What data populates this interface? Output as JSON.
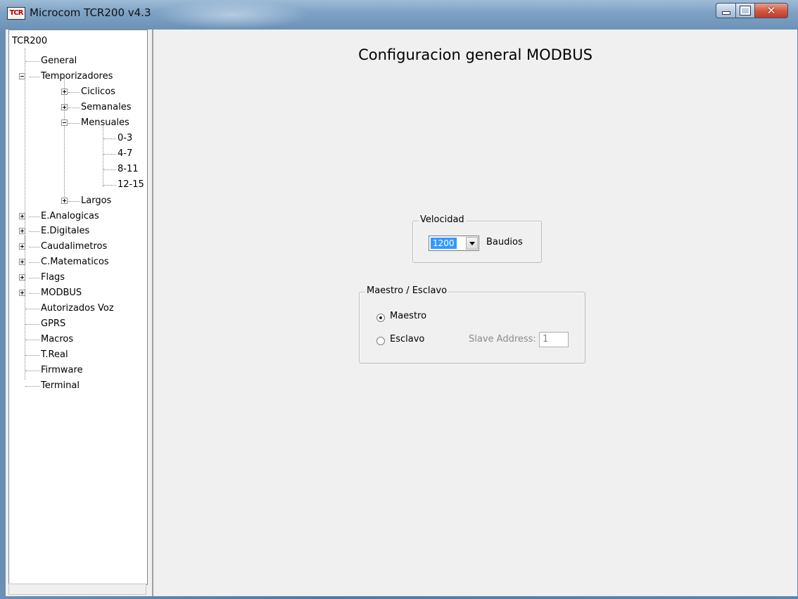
{
  "window": {
    "title": "Microcom TCR200 v4.3",
    "icon_text": "TCR",
    "controls": [
      "minimize-icon",
      "maximize-icon",
      "close-icon"
    ],
    "accent_color": "#3399ff"
  },
  "tree": {
    "root": "TCR200",
    "nodes": [
      {
        "label": "General"
      },
      {
        "label": "Temporizadores",
        "state": "expanded"
      },
      {
        "label": "Ciclicos",
        "state": "collapsed"
      },
      {
        "label": "Semanales",
        "state": "collapsed"
      },
      {
        "label": "Mensuales",
        "state": "expanded"
      },
      {
        "label": "0-3"
      },
      {
        "label": "4-7"
      },
      {
        "label": "8-11"
      },
      {
        "label": "12-15"
      },
      {
        "label": "Largos",
        "state": "collapsed"
      },
      {
        "label": "E.Analogicas",
        "state": "collapsed"
      },
      {
        "label": "E.Digitales",
        "state": "collapsed"
      },
      {
        "label": "Caudalimetros",
        "state": "collapsed"
      },
      {
        "label": "C.Matematicos",
        "state": "collapsed"
      },
      {
        "label": "Flags",
        "state": "collapsed"
      },
      {
        "label": "MODBUS",
        "state": "collapsed"
      },
      {
        "label": "Autorizados Voz"
      },
      {
        "label": "GPRS"
      },
      {
        "label": "Macros"
      },
      {
        "label": "T.Real"
      },
      {
        "label": "Firmware"
      },
      {
        "label": "Terminal"
      }
    ]
  },
  "main": {
    "title": "Configuracion general MODBUS",
    "speed_group": {
      "label": "Velocidad",
      "selected": "1200",
      "unit": "Baudios"
    },
    "mode_group": {
      "label": "Maestro / Esclavo",
      "master_label": "Maestro",
      "master_selected": true,
      "slave_label": "Esclavo",
      "slave_selected": false,
      "address_label": "Slave Address:",
      "address_value": "1"
    }
  }
}
